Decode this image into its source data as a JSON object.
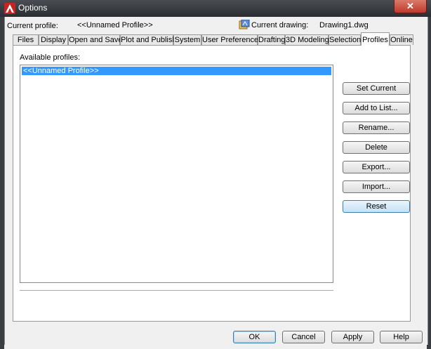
{
  "window": {
    "title": "Options"
  },
  "header": {
    "current_profile_label": "Current profile:",
    "current_profile_value": "<<Unnamed Profile>>",
    "current_drawing_label": "Current drawing:",
    "current_drawing_value": "Drawing1.dwg"
  },
  "tabs": [
    {
      "label": "Files"
    },
    {
      "label": "Display"
    },
    {
      "label": "Open and Save"
    },
    {
      "label": "Plot and Publish"
    },
    {
      "label": "System"
    },
    {
      "label": "User Preferences"
    },
    {
      "label": "Drafting"
    },
    {
      "label": "3D Modeling"
    },
    {
      "label": "Selection"
    },
    {
      "label": "Profiles",
      "active": true
    },
    {
      "label": "Online"
    }
  ],
  "profiles": {
    "list_label": "Available profiles:",
    "items": [
      "<<Unnamed Profile>>"
    ],
    "selected_index": 0
  },
  "actions": {
    "set_current": "Set Current",
    "add_to_list": "Add to List...",
    "rename": "Rename...",
    "delete": "Delete",
    "export": "Export...",
    "import": "Import...",
    "reset": "Reset"
  },
  "footer": {
    "ok": "OK",
    "cancel": "Cancel",
    "apply": "Apply",
    "help": "Help"
  },
  "colors": {
    "selection": "#3399ff",
    "accent": "#3c7fb1",
    "close": "#c0392b"
  }
}
